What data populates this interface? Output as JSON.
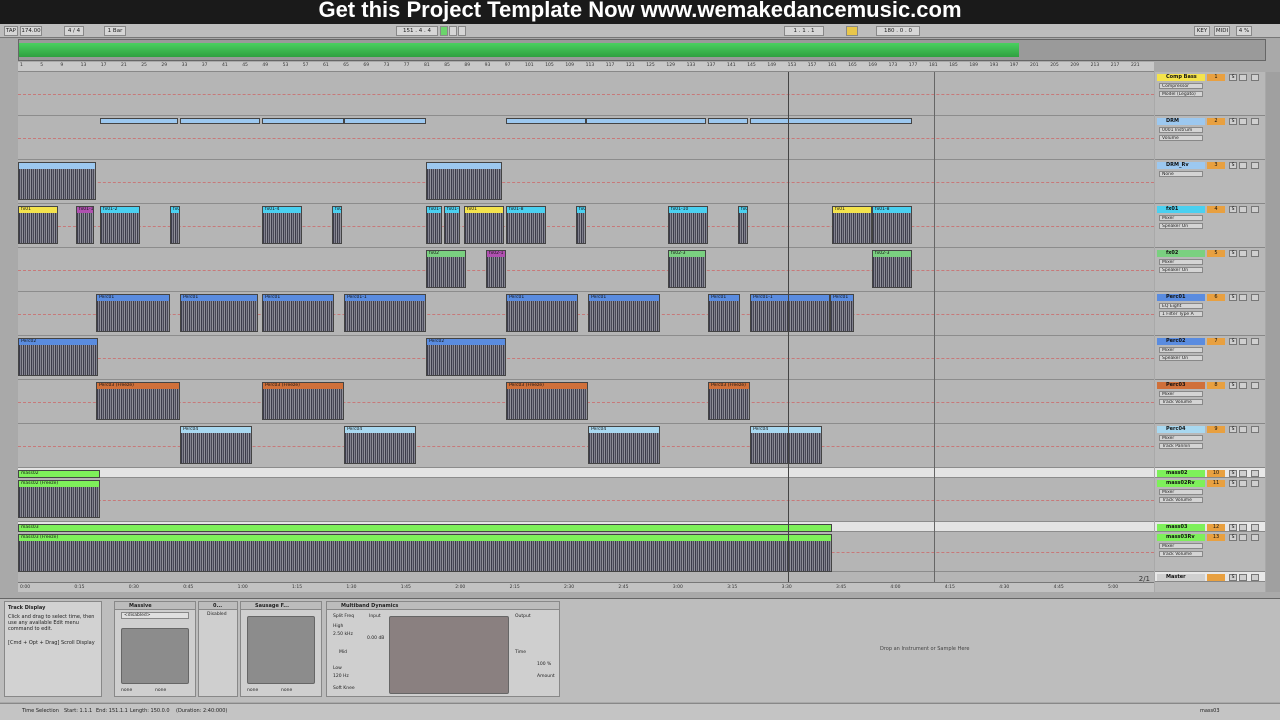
{
  "banner": "Get this Project Template Now www.wemakedancemusic.com",
  "transport": {
    "tap": "TAP",
    "tempo": "174.00",
    "signature": "4 / 4",
    "quantize": "1 Bar",
    "position": "151 . 4 . 4",
    "loop_start": "1 . 1 . 1",
    "loop_length": "180 . 0 . 0",
    "key": "KEY",
    "midi": "MIDI",
    "cpu": "4 %"
  },
  "ruler_marks": [
    "1",
    "5",
    "9",
    "13",
    "17",
    "21",
    "25",
    "29",
    "33",
    "37",
    "41",
    "45",
    "49",
    "53",
    "57",
    "61",
    "65",
    "69",
    "73",
    "77",
    "81",
    "85",
    "89",
    "93",
    "97",
    "101",
    "105",
    "109",
    "113",
    "117",
    "121",
    "125",
    "129",
    "133",
    "137",
    "141",
    "145",
    "149",
    "153",
    "157",
    "161",
    "165",
    "169",
    "173",
    "177",
    "181",
    "185",
    "189",
    "193",
    "197",
    "201",
    "205",
    "209",
    "213",
    "217",
    "221"
  ],
  "time_marks": [
    "0:00",
    "0:15",
    "0:30",
    "0:45",
    "1:00",
    "1:15",
    "1:30",
    "1:45",
    "2:00",
    "2:15",
    "2:30",
    "2:45",
    "3:00",
    "3:15",
    "3:30",
    "3:45",
    "4:00",
    "4:15",
    "4:30",
    "4:45",
    "5:00"
  ],
  "tracks": [
    {
      "name": "Comp Bass",
      "num": "1",
      "vol": "",
      "devices": [
        "Compressor",
        "Model (Legato)"
      ],
      "color": "#f4e34c",
      "clips": []
    },
    {
      "name": "DRM",
      "num": "2",
      "vol": "",
      "devices": [
        "0001 Instrum",
        "Volume"
      ],
      "color": "#9cc8f0",
      "clips": []
    },
    {
      "name": "DRM_Rv",
      "num": "3",
      "vol": "",
      "devices": [
        "None"
      ],
      "color": "#9cc8f0",
      "clips": []
    },
    {
      "name": "fx01",
      "num": "4",
      "vol": "",
      "devices": [
        "Mixer",
        "Speaker On"
      ],
      "color": "#4ad0f0",
      "clips": []
    },
    {
      "name": "fx02",
      "num": "5",
      "vol": "",
      "devices": [
        "Mixer",
        "Speaker On"
      ],
      "color": "#7ad080",
      "clips": []
    },
    {
      "name": "Perc01",
      "num": "6",
      "vol": "",
      "devices": [
        "EQ Eight",
        "1 Filter Type A"
      ],
      "color": "#5a8ce0",
      "clips": []
    },
    {
      "name": "Perc02",
      "num": "7",
      "vol": "",
      "devices": [
        "Mixer",
        "Speaker On"
      ],
      "color": "#5a8ce0",
      "clips": []
    },
    {
      "name": "Perc03",
      "num": "8",
      "vol": "",
      "devices": [
        "Mixer",
        "Track Volume"
      ],
      "color": "#d0703a",
      "clips": []
    },
    {
      "name": "Perc04",
      "num": "9",
      "vol": "",
      "devices": [
        "Mixer",
        "Track Pannin"
      ],
      "color": "#a8d8f0",
      "clips": []
    },
    {
      "name": "mass02",
      "num": "10",
      "vol": "",
      "devices": [],
      "color": "#7ef05a",
      "clips": []
    },
    {
      "name": "mass02Rv",
      "num": "11",
      "vol": "",
      "devices": [
        "Mixer",
        "Track Volume"
      ],
      "color": "#7ef05a",
      "clips": []
    },
    {
      "name": "mass03",
      "num": "12",
      "vol": "",
      "devices": [],
      "color": "#7ef05a",
      "clips": []
    },
    {
      "name": "mass03Rv",
      "num": "13",
      "vol": "",
      "devices": [
        "Mixer",
        "Track Volume"
      ],
      "color": "#7ef05a",
      "clips": []
    },
    {
      "name": "Master",
      "num": "",
      "vol": "",
      "devices": [],
      "color": "#d0d0d0",
      "clips": []
    }
  ],
  "clip_labels": {
    "drm": "",
    "fx01": [
      "fx01",
      "fx01-1",
      "fx01-2",
      "fx01",
      "fx01-4",
      "fx01",
      "fx01-6",
      "fx01-7",
      "fx01",
      "fx01-8",
      "fx01",
      "fx01-10",
      "fx01",
      "fx01",
      "fx01-8"
    ],
    "fx02": [
      "fx02",
      "fx02-1",
      "fx02-3",
      "fx02-3"
    ],
    "perc01": [
      "Perc01",
      "Perc01",
      "Perc01",
      "Perc01-1",
      "Perc01",
      "Perc01",
      "Perc01",
      "Perc01-1",
      "Perc01"
    ],
    "perc02": [
      "Perc02",
      "Perc02"
    ],
    "perc03": [
      "Perc03 (Freeze)",
      "Perc03 (Freeze)",
      "Perc03 (Freeze)",
      "Perc03 (Freeze)"
    ],
    "perc04": [
      "Perc04",
      "Perc04",
      "Perc04",
      "Perc04"
    ],
    "mass02": [
      "mass02",
      "mass02 (Freeze)"
    ],
    "mass03": [
      "mass03",
      "mass03 (Freeze)"
    ]
  },
  "loop_brace": "2/1",
  "help": {
    "title": "Track Display",
    "body": "Click and drag to select time, then use any available Edit menu command to edit.",
    "hint": "[Cmd + Opt + Drag] Scroll Display"
  },
  "devices": {
    "massive": {
      "title": "Massive",
      "preset": "<disabled>",
      "knob1": "none",
      "knob2": "none"
    },
    "d2": {
      "title": "0...",
      "sub": "Disabled"
    },
    "sausage": {
      "title": "Sausage F...",
      "knob1": "none",
      "knob2": "none"
    },
    "multiband": {
      "title": "Multiband Dynamics",
      "split": "Split Freq",
      "input": "Input",
      "output": "Output",
      "high": "High",
      "mid": "Mid",
      "low": "Low",
      "freq1": "2.50 kHz",
      "freq2": "120 Hz",
      "db": "0.00 dB",
      "time": "Time",
      "amount": "Amount",
      "pct": "100 %",
      "solo": "Soft Knee"
    }
  },
  "drop_text": "Drop an Instrument or Sample Here",
  "status": {
    "label": "Time Selection",
    "start": "Start: 1.1.1",
    "end": "End: 151.1.1",
    "length": "Length: 150.0.0",
    "duration": "(Duration: 2:40:000)",
    "track": "mass03"
  }
}
